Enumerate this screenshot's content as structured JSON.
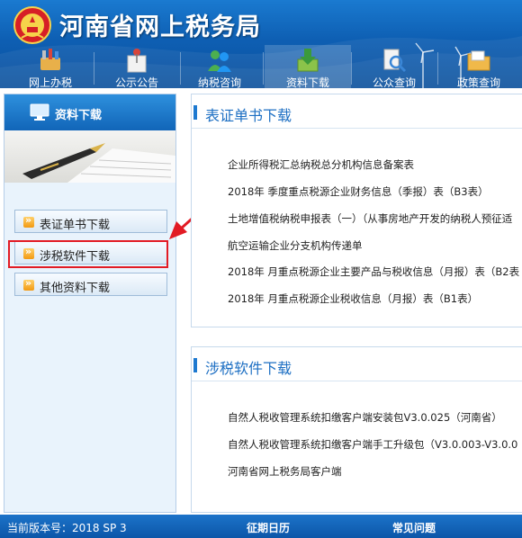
{
  "header": {
    "site_title": "河南省网上税务局",
    "nav": [
      {
        "label": "网上办税",
        "icon": "tools-icon"
      },
      {
        "label": "公示公告",
        "icon": "notice-pin-icon"
      },
      {
        "label": "纳税咨询",
        "icon": "people-consult-icon"
      },
      {
        "label": "资料下载",
        "icon": "download-box-icon",
        "active": true
      },
      {
        "label": "公众查询",
        "icon": "magnifier-query-icon"
      },
      {
        "label": "政策查询",
        "icon": "folder-icon"
      }
    ]
  },
  "sidebar": {
    "title": "资料下载",
    "menu": [
      {
        "label": "表证单书下载"
      },
      {
        "label": "涉税软件下载",
        "highlighted": true
      },
      {
        "label": "其他资料下载"
      }
    ]
  },
  "sections": [
    {
      "title": "表证单书下载",
      "items": [
        "企业所得税汇总纳税总分机构信息备案表",
        "2018年 季度重点税源企业财务信息（季报）表（B3表）",
        "土地增值税纳税申报表（一）（从事房地产开发的纳税人预征适",
        "航空运输企业分支机构传递单",
        "2018年 月重点税源企业主要产品与税收信息（月报）表（B2表",
        "2018年 月重点税源企业税收信息（月报）表（B1表）"
      ]
    },
    {
      "title": "涉税软件下载",
      "items": [
        "自然人税收管理系统扣缴客户端安装包V3.0.025（河南省）",
        "自然人税收管理系统扣缴客户端手工升级包（V3.0.003-V3.0.0",
        "河南省网上税务局客户端"
      ]
    }
  ],
  "footer": {
    "version": "当前版本号：2018 SP 3",
    "calendar": "征期日历",
    "faq": "常见问题"
  },
  "colors": {
    "header_blue": "#0e5fb3",
    "accent_blue": "#1d6fc3",
    "highlight_red": "#e21b24"
  }
}
